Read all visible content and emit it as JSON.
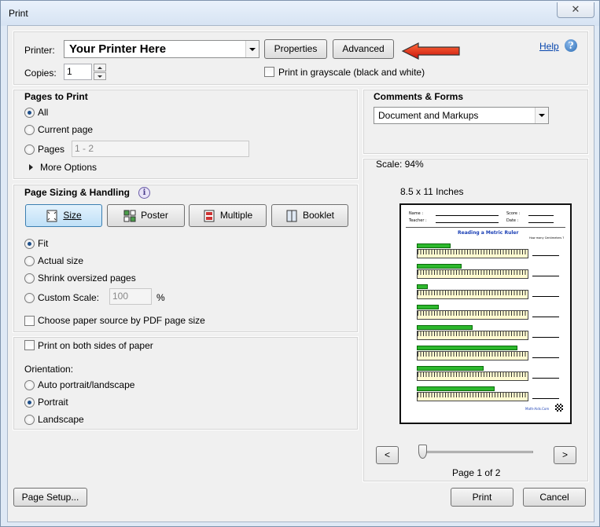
{
  "window": {
    "title": "Print",
    "close_label": "✕"
  },
  "printer": {
    "label": "Printer:",
    "value": "Your Printer Here",
    "properties_label": "Properties",
    "advanced_label": "Advanced",
    "help_label": "Help",
    "copies_label": "Copies:",
    "copies_value": "1",
    "grayscale_label": "Print in grayscale (black and white)",
    "grayscale_checked": false
  },
  "pages_to_print": {
    "title": "Pages to Print",
    "options": [
      {
        "label": "All",
        "checked": true
      },
      {
        "label": "Current page",
        "checked": false
      },
      {
        "label": "Pages",
        "checked": false
      }
    ],
    "pages_value": "1 - 2",
    "more_options_label": "More Options"
  },
  "comments_forms": {
    "title": "Comments & Forms",
    "value": "Document and Markups"
  },
  "page_sizing": {
    "title": "Page Sizing & Handling",
    "buttons": [
      {
        "label": "Size",
        "active": true
      },
      {
        "label": "Poster",
        "active": false
      },
      {
        "label": "Multiple",
        "active": false
      },
      {
        "label": "Booklet",
        "active": false
      }
    ],
    "options": [
      {
        "label": "Fit",
        "checked": true
      },
      {
        "label": "Actual size",
        "checked": false
      },
      {
        "label": "Shrink oversized pages",
        "checked": false
      },
      {
        "label": "Custom Scale:",
        "checked": false
      }
    ],
    "scale_value": "100",
    "percent_label": "%",
    "paper_source_label": "Choose paper source by PDF page size"
  },
  "duplex": {
    "both_sides_label": "Print on both sides of paper",
    "orientation_label": "Orientation:",
    "options": [
      {
        "label": "Auto portrait/landscape",
        "checked": false
      },
      {
        "label": "Portrait",
        "checked": true
      },
      {
        "label": "Landscape",
        "checked": false
      }
    ]
  },
  "preview": {
    "scale_label": "Scale:  94%",
    "paper_size_label": "8.5 x 11 Inches",
    "page_label": "Page 1 of 2",
    "prev_label": "<",
    "next_label": ">",
    "slider_position": 0,
    "worksheet": {
      "name_label": "Name :",
      "teacher_label": "Teacher :",
      "score_label": "Score :",
      "date_label": "Date :",
      "title": "Reading a Metric Ruler",
      "question": "How many Centimeters ?",
      "footer": "Math-Aids.Com",
      "bar_lengths_cm": [
        6,
        8,
        2,
        4,
        10,
        18,
        12,
        14
      ],
      "ruler_max_cm": 20
    }
  },
  "footer": {
    "page_setup_label": "Page Setup...",
    "print_label": "Print",
    "cancel_label": "Cancel"
  },
  "colors": {
    "arrow": "#e8251c",
    "bar": "#2db82d",
    "ruler": "#fffbd0"
  }
}
